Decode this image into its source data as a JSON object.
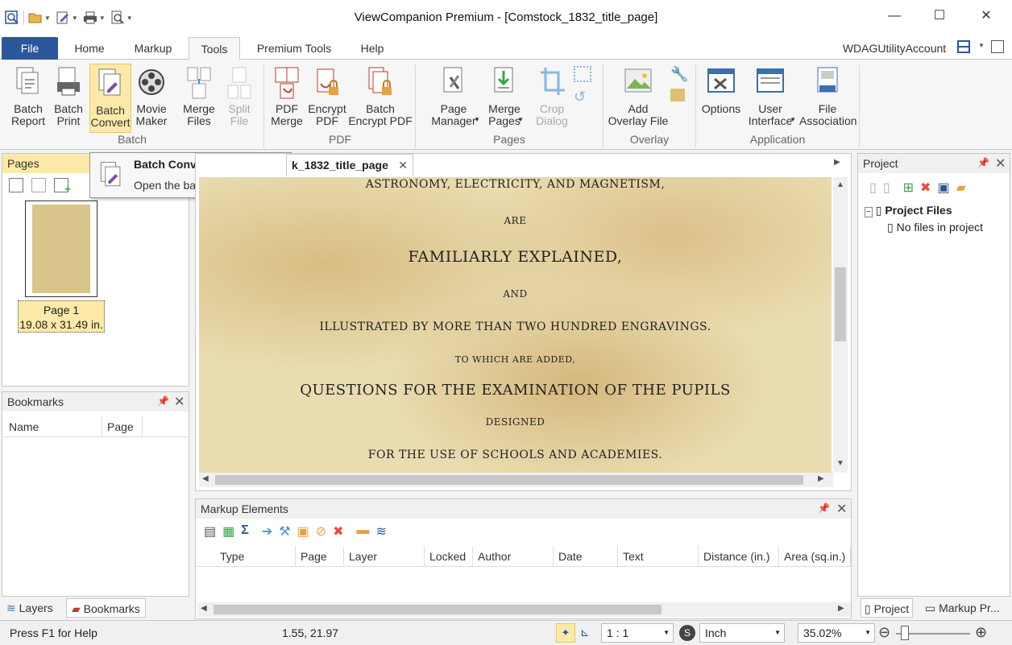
{
  "window": {
    "title": "ViewCompanion Premium - [Comstock_1832_title_page]"
  },
  "menu": {
    "tabs": [
      "File",
      "Home",
      "Markup",
      "Tools",
      "Premium Tools",
      "Help"
    ],
    "account": "WDAGUtilityAccount"
  },
  "ribbon": {
    "batch": {
      "report": "Batch\nReport",
      "print": "Batch\nPrint",
      "convert": "Batch\nConvert",
      "movie": "Movie\nMaker",
      "merge": "Merge\nFiles",
      "split": "Split\nFile",
      "group": "Batch"
    },
    "pdf": {
      "merge": "PDF\nMerge",
      "encrypt": "Encrypt\nPDF",
      "batch_encrypt": "Batch\nEncrypt PDF",
      "group": "PDF"
    },
    "pages": {
      "manager": "Page\nManager",
      "merge": "Merge\nPages",
      "crop": "Crop\nDialog",
      "group": "Pages"
    },
    "overlay": {
      "add": "Add\nOverlay File",
      "group": "Overlay"
    },
    "application": {
      "options": "Options",
      "ui": "User\nInterface",
      "assoc": "File\nAssociation",
      "group": "Application"
    }
  },
  "tooltip": {
    "title": "Batch Convert",
    "text": "Open the batch convert dialog"
  },
  "pages_panel": {
    "title": "Pages",
    "page_label": "Page 1",
    "page_size": "19.08 x 31.49 in."
  },
  "bookmarks_panel": {
    "title": "Bookmarks",
    "cols": [
      "Name",
      "Page"
    ]
  },
  "bottom_tabs": {
    "layers": "Layers",
    "bookmarks": "Bookmarks",
    "project": "Project",
    "markup": "Markup Pr..."
  },
  "document": {
    "tab": "k_1832_title_page",
    "lines": [
      "ASTRONOMY, ELECTRICITY, AND MAGNETISM,",
      "ARE",
      "FAMILIARLY EXPLAINED,",
      "AND",
      "ILLUSTRATED BY MORE THAN TWO HUNDRED ENGRAVINGS.",
      "TO WHICH ARE ADDED,",
      "QUESTIONS FOR THE EXAMINATION OF THE PUPILS",
      "DESIGNED",
      "FOR THE USE OF SCHOOLS AND ACADEMIES."
    ]
  },
  "markup_panel": {
    "title": "Markup Elements",
    "cols": [
      "Type",
      "Page",
      "Layer",
      "Locked",
      "Author",
      "Date",
      "Text",
      "Distance (in.)",
      "Area (sq.in.)"
    ]
  },
  "project_panel": {
    "title": "Project",
    "root": "Project Files",
    "empty": "No files in project"
  },
  "status": {
    "help": "Press F1 for Help",
    "coords": "1.55, 21.97",
    "scale": "1 : 1",
    "unit": "Inch",
    "zoom": "35.02%"
  }
}
